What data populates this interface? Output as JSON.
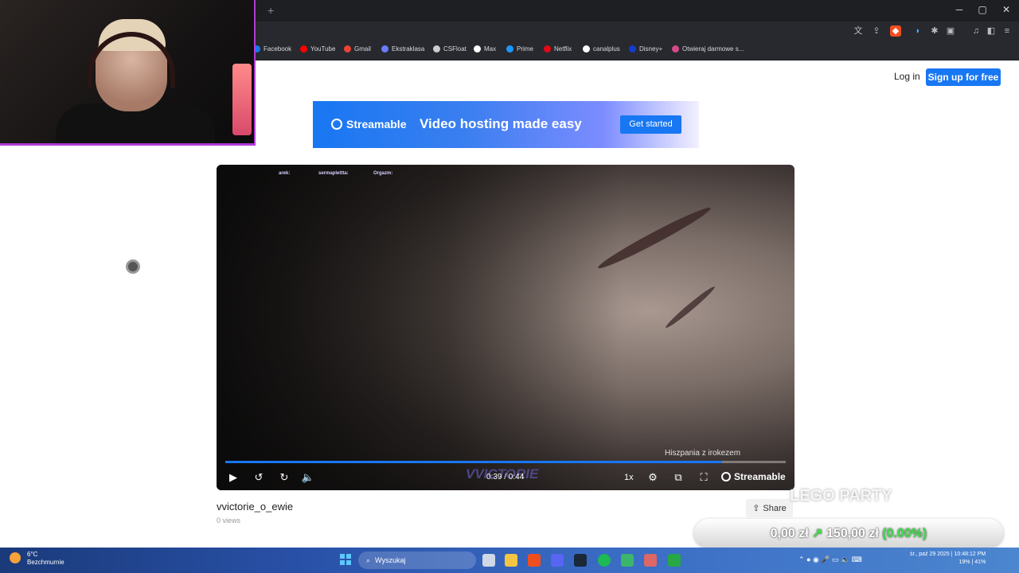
{
  "browser": {
    "new_tab": "+",
    "window_controls": {
      "minimize": "─",
      "maximize": "▢",
      "close": "✕"
    },
    "bookmarks": [
      {
        "label": "Facebook",
        "color": "#1877f2"
      },
      {
        "label": "YouTube",
        "color": "#ff0000"
      },
      {
        "label": "Gmail",
        "color": "#ea4335"
      },
      {
        "label": "Ekstraklasa",
        "color": "#6b7cff"
      },
      {
        "label": "CSFloat",
        "color": "#cccccc"
      },
      {
        "label": "Max",
        "color": "#ffffff"
      },
      {
        "label": "Prime",
        "color": "#1a98ff"
      },
      {
        "label": "Netflix",
        "color": "#e50914"
      },
      {
        "label": "canalplus",
        "color": "#ffffff"
      },
      {
        "label": "Disney+",
        "color": "#113ccf"
      },
      {
        "label": "Otwieraj darmowe s...",
        "color": "#d64a8a"
      }
    ]
  },
  "header": {
    "login": "Log in",
    "signup": "Sign up for free"
  },
  "banner": {
    "brand": "Streamable",
    "tagline": "Video hosting made easy",
    "cta": "Get started"
  },
  "video": {
    "chat_names": [
      "arek:",
      "sermaplettta:",
      "Orgazm:"
    ],
    "watermark": "VVICTORIE",
    "caption": "Hiszpania z irokezem",
    "progress": 0.886,
    "timecode": "0:39 / 0:44",
    "speed": "1x",
    "brand": "Streamable",
    "title": "vvictorie_o_ewie",
    "views": "0 views",
    "share": "Share"
  },
  "overlay": {
    "game": "LEGO PARTY",
    "balance_start": "0,00 zł",
    "arrow": "↗",
    "balance_end": "150,00 zł",
    "percent": "(0.00%)"
  },
  "taskbar": {
    "weather_temp": "6°C",
    "weather_desc": "Bezchmurnie",
    "search": "Wyszukaj",
    "clock_date": "śr., paź 29 2025 | 10:48:12 PM",
    "clock_stats": "19% | 41%"
  }
}
